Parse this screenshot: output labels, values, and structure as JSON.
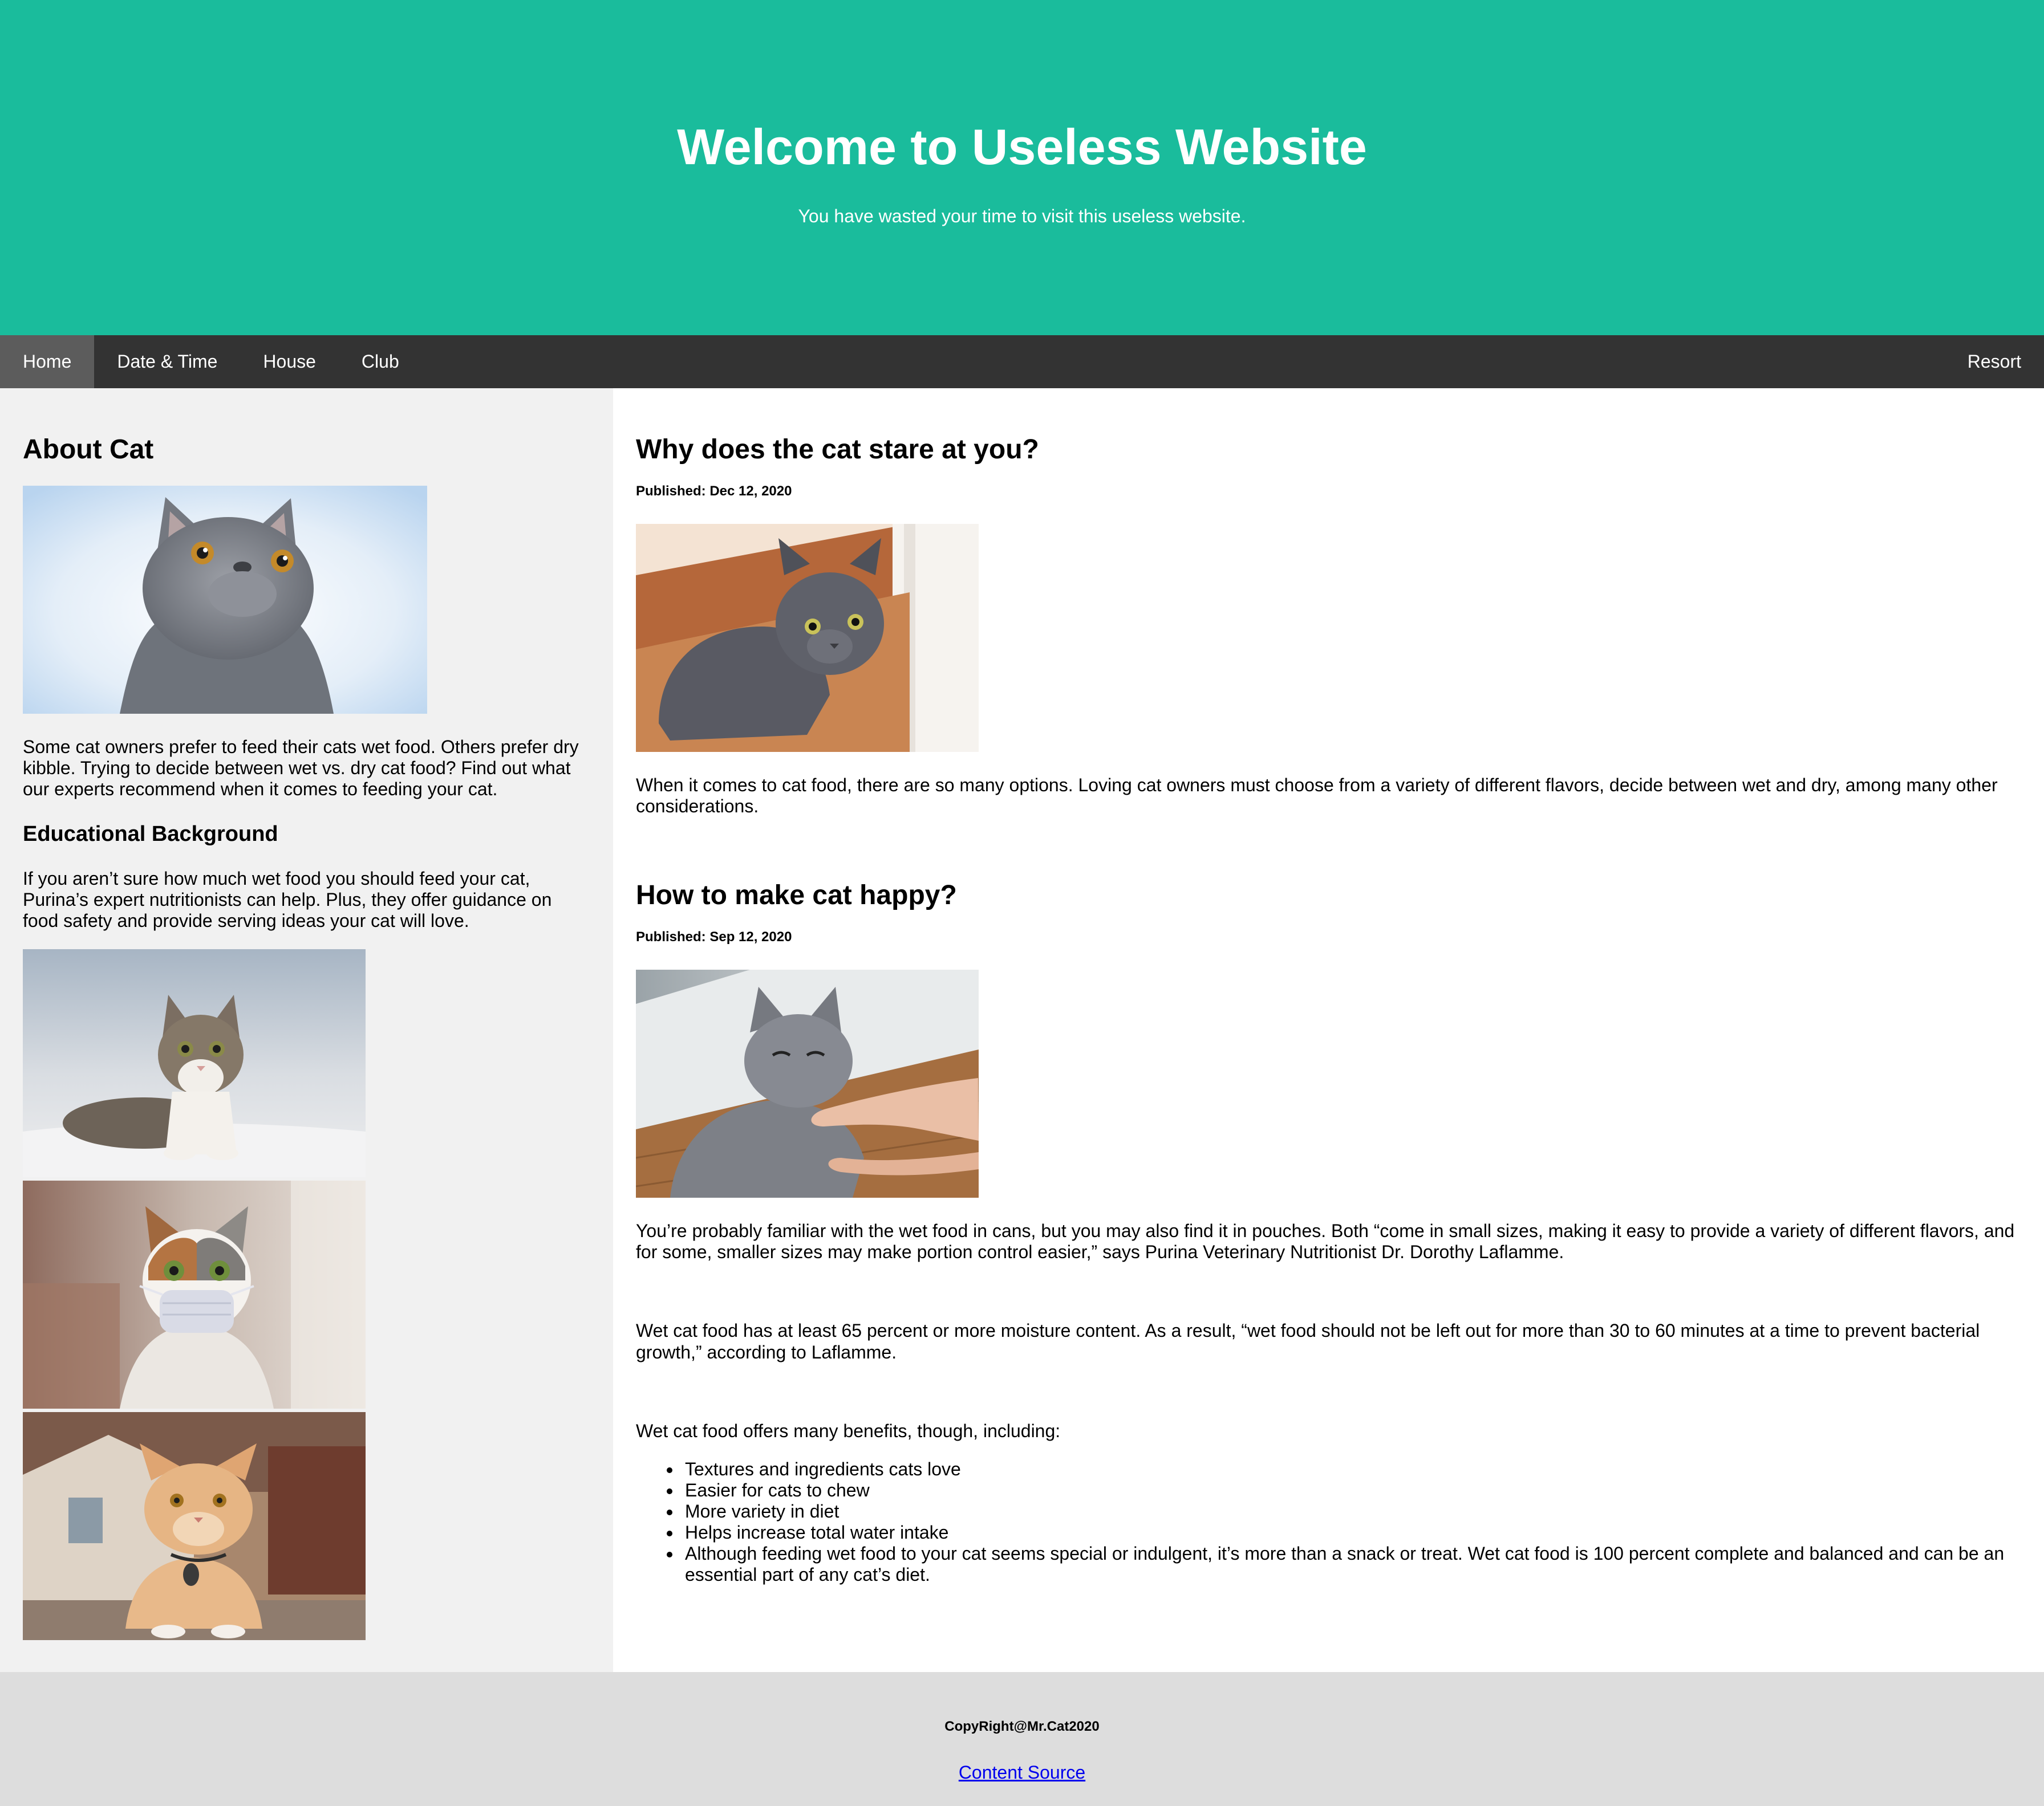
{
  "header": {
    "title": "Welcome to Useless Website",
    "subtitle": "You have wasted your time to visit this useless website."
  },
  "nav": {
    "items": [
      {
        "label": "Home",
        "active": true
      },
      {
        "label": "Date & Time"
      },
      {
        "label": "House"
      },
      {
        "label": "Club"
      }
    ],
    "right_item": "Resort"
  },
  "sidebar": {
    "title": "About Cat",
    "intro": "Some cat owners prefer to feed their cats wet food. Others prefer dry kibble. Trying to decide between wet vs. dry cat food? Find out what our experts recommend when it comes to feeding your cat.",
    "subtitle": "Educational Background",
    "body": "If you aren’t sure how much wet food you should feed your cat, Purina’s expert nutritionists can help. Plus, they offer guidance on food safety and provide serving ideas your cat will love."
  },
  "articles": [
    {
      "title": "Why does the cat stare at you?",
      "published": "Published: Dec 12, 2020",
      "body": "When it comes to cat food, there are so many options. Loving cat owners must choose from a variety of different flavors, decide between wet and dry, among many other considerations."
    },
    {
      "title": "How to make cat happy?",
      "published": "Published: Sep 12, 2020",
      "paragraphs": [
        "You’re probably familiar with the wet food in cans, but you may also find it in pouches. Both “come in small sizes, making it easy to provide a variety of different flavors, and for some, smaller sizes may make portion control easier,” says Purina Veterinary Nutritionist Dr. Dorothy Laflamme.",
        "Wet cat food has at least 65 percent or more moisture content. As a result, “wet food should not be left out for more than 30 to 60 minutes at a time to prevent bacterial growth,” according to Laflamme.",
        "Wet cat food offers many benefits, though, including:"
      ],
      "benefits": [
        "Textures and ingredients cats love",
        "Easier for cats to chew",
        "More variety in diet",
        "Helps increase total water intake",
        "Although feeding wet food to your cat seems special or indulgent, it’s more than a snack or treat. Wet cat food is 100 percent complete and balanced and can be an essential part of any cat’s diet."
      ]
    }
  ],
  "footer": {
    "copyright": "CopyRight@Mr.Cat2020",
    "link": "Content Source"
  },
  "colors": {
    "header_bg": "#1abc9c",
    "nav_bg": "#333333",
    "nav_active": "#5c5c5c",
    "sidebar_bg": "#f1f1f1",
    "footer_bg": "#dddddd",
    "link": "#0000ee"
  }
}
